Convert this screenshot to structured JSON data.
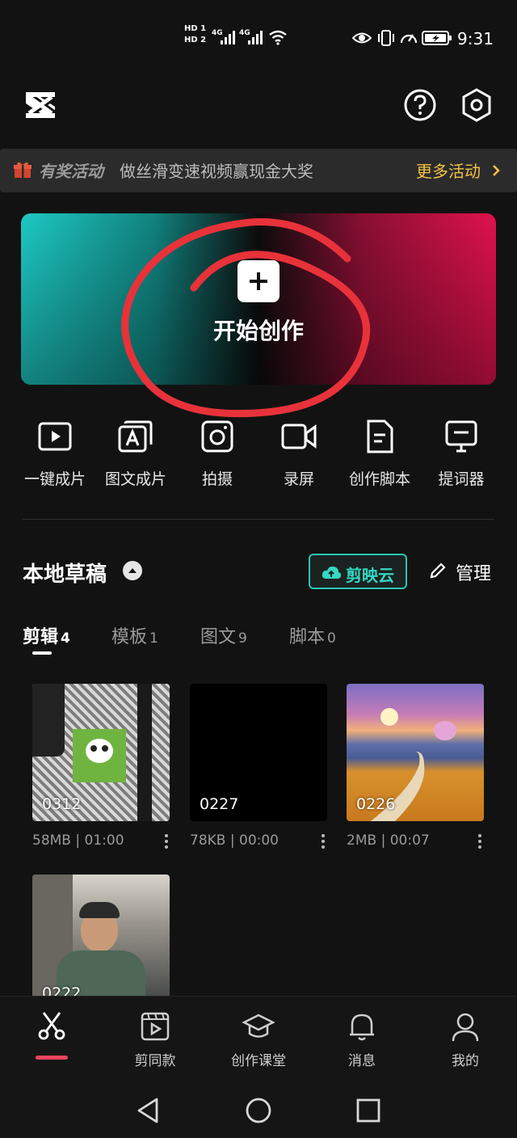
{
  "status_bar": {
    "time": "9:31",
    "sim1": "HD 1",
    "sim2": "HD 2",
    "net1": "4G",
    "net2": "4G"
  },
  "header": {
    "logo": "capcut-logo-icon",
    "help_icon": "help-icon",
    "settings_icon": "hexagon-settings-icon"
  },
  "promo": {
    "tag": "有奖活动",
    "text": "做丝滑变速视频赢现金大奖",
    "more": "更多活动"
  },
  "hero": {
    "label": "开始创作"
  },
  "tools": [
    {
      "label": "一键成片",
      "icon": "play-square-icon"
    },
    {
      "label": "图文成片",
      "icon": "text-image-icon"
    },
    {
      "label": "拍摄",
      "icon": "camera-icon"
    },
    {
      "label": "录屏",
      "icon": "video-camera-icon"
    },
    {
      "label": "创作脚本",
      "icon": "script-document-icon"
    },
    {
      "label": "提词器",
      "icon": "teleprompter-icon"
    }
  ],
  "drafts": {
    "title": "本地草稿",
    "cloud_label": "剪映云",
    "manage_label": "管理"
  },
  "tabs": [
    {
      "label": "剪辑",
      "count": "4"
    },
    {
      "label": "模板",
      "count": "1"
    },
    {
      "label": "图文",
      "count": "9"
    },
    {
      "label": "脚本",
      "count": "0"
    }
  ],
  "projects": [
    {
      "name": "0312",
      "size": "58MB",
      "duration": "01:00"
    },
    {
      "name": "0227",
      "size": "78KB",
      "duration": "00:00"
    },
    {
      "name": "0226",
      "size": "2MB",
      "duration": "00:07"
    },
    {
      "name": "0222",
      "size": "",
      "duration": ""
    }
  ],
  "meta_sep": "|",
  "bottom_nav": [
    {
      "label": "",
      "icon": "scissors-icon"
    },
    {
      "label": "剪同款",
      "icon": "template-film-icon"
    },
    {
      "label": "创作课堂",
      "icon": "graduation-cap-icon"
    },
    {
      "label": "消息",
      "icon": "bell-icon"
    },
    {
      "label": "我的",
      "icon": "user-icon"
    }
  ],
  "colors": {
    "accent_teal": "#27c7b3",
    "promo_more": "#f6c244",
    "nav_active": "#f0455f",
    "scribble": "#e8323a"
  }
}
